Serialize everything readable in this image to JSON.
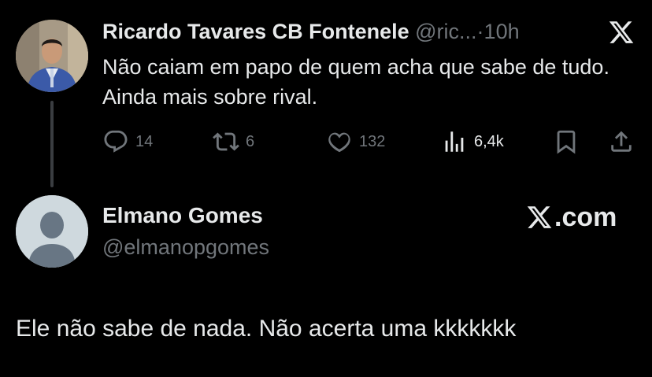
{
  "original_tweet": {
    "author_name": "Ricardo Tavares CB Fontenele",
    "handle": "@ric...",
    "dot": "·",
    "time": "10h",
    "text": "Não caiam em papo de quem acha que sabe de tudo. Ainda mais sobre rival.",
    "actions": {
      "replies": "14",
      "reposts": "6",
      "likes": "132",
      "views": "6,4k"
    }
  },
  "reply": {
    "author_name": "Elmano Gomes",
    "handle": "@elmanopgomes",
    "brand": ".com",
    "text": "Ele não sabe de nada. Não acerta uma kkkkkkk"
  },
  "icons": {
    "x_logo": "x-logo-icon",
    "reply": "reply-icon",
    "repost": "repost-icon",
    "like": "heart-icon",
    "views": "views-icon",
    "bookmark": "bookmark-icon",
    "share": "share-icon",
    "default_avatar": "default-avatar-icon"
  },
  "colors": {
    "background": "#000000",
    "primary_text": "#e7e9ea",
    "secondary_text": "#71767b",
    "thread_line": "#3a3d41",
    "default_avatar_bg": "#cfd9de",
    "default_avatar_fg": "#687684"
  }
}
